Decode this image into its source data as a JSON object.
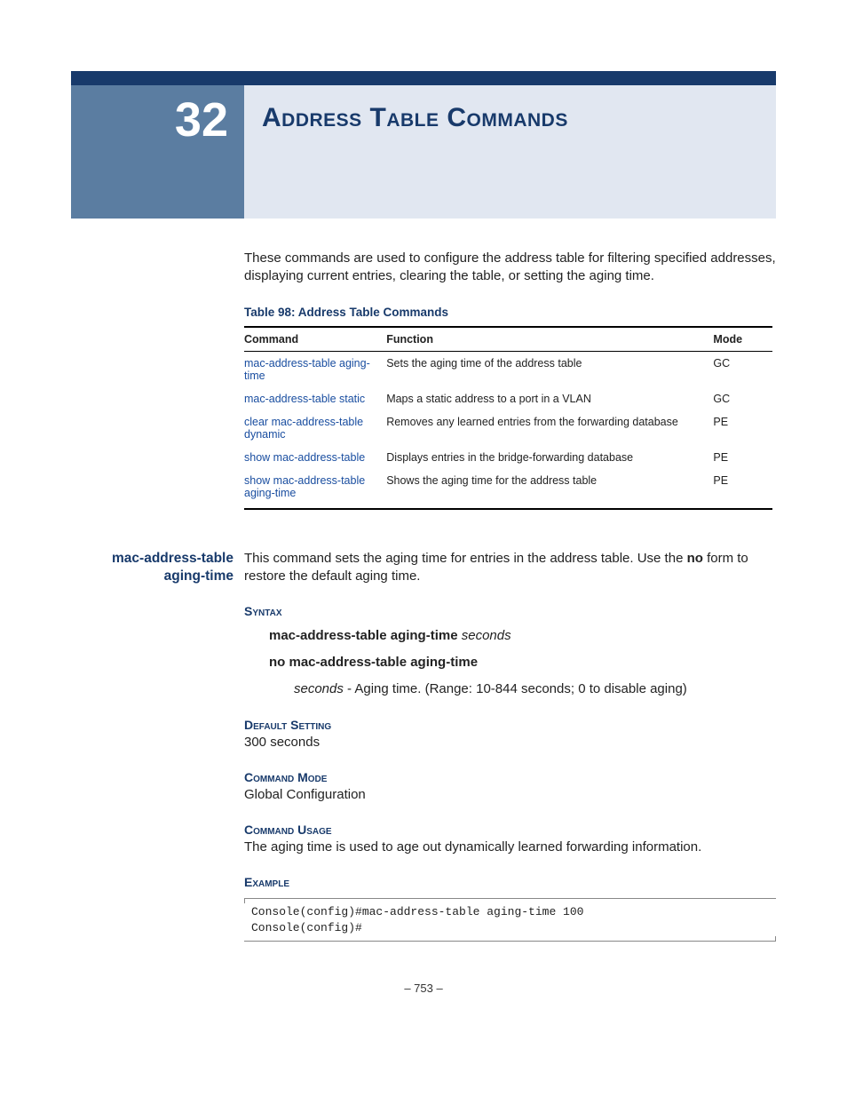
{
  "chapter": {
    "number": "32",
    "title": "Address Table Commands"
  },
  "intro": "These commands are used to configure the address table for filtering specified addresses, displaying current entries, clearing the table, or setting the aging time.",
  "table": {
    "caption": "Table 98: Address Table Commands",
    "headers": {
      "command": "Command",
      "function": "Function",
      "mode": "Mode"
    },
    "rows": [
      {
        "command": "mac-address-table aging-time",
        "function": "Sets the aging time of the address table",
        "mode": "GC"
      },
      {
        "command": "mac-address-table static",
        "function": "Maps a static address to a port in a VLAN",
        "mode": "GC"
      },
      {
        "command": "clear mac-address-table dynamic",
        "function": "Removes any learned entries from the forwarding database",
        "mode": "PE"
      },
      {
        "command": "show mac-address-table",
        "function": "Displays entries in the bridge-forwarding database",
        "mode": "PE"
      },
      {
        "command": "show mac-address-table aging-time",
        "function": "Shows the aging time for the address table",
        "mode": "PE"
      }
    ]
  },
  "detail": {
    "name_line1": "mac-address-table",
    "name_line2": "aging-time",
    "summary_pre": "This command sets the aging time for entries in the address table. Use the ",
    "summary_bold": "no",
    "summary_post": " form to restore the default aging time.",
    "syntax_head": "Syntax",
    "syntax_cmd": "mac-address-table aging-time",
    "syntax_arg": "seconds",
    "syntax_no": "no mac-address-table aging-time",
    "param_name": "seconds",
    "param_desc": " - Aging time. (Range: 10-844 seconds; 0 to disable aging)",
    "default_head": "Default Setting",
    "default_val": "300 seconds",
    "mode_head": "Command Mode",
    "mode_val": "Global Configuration",
    "usage_head": "Command Usage",
    "usage_val": "The aging time is used to age out dynamically learned forwarding information.",
    "example_head": "Example",
    "example_code": "Console(config)#mac-address-table aging-time 100\nConsole(config)#"
  },
  "footer": "– 753 –"
}
